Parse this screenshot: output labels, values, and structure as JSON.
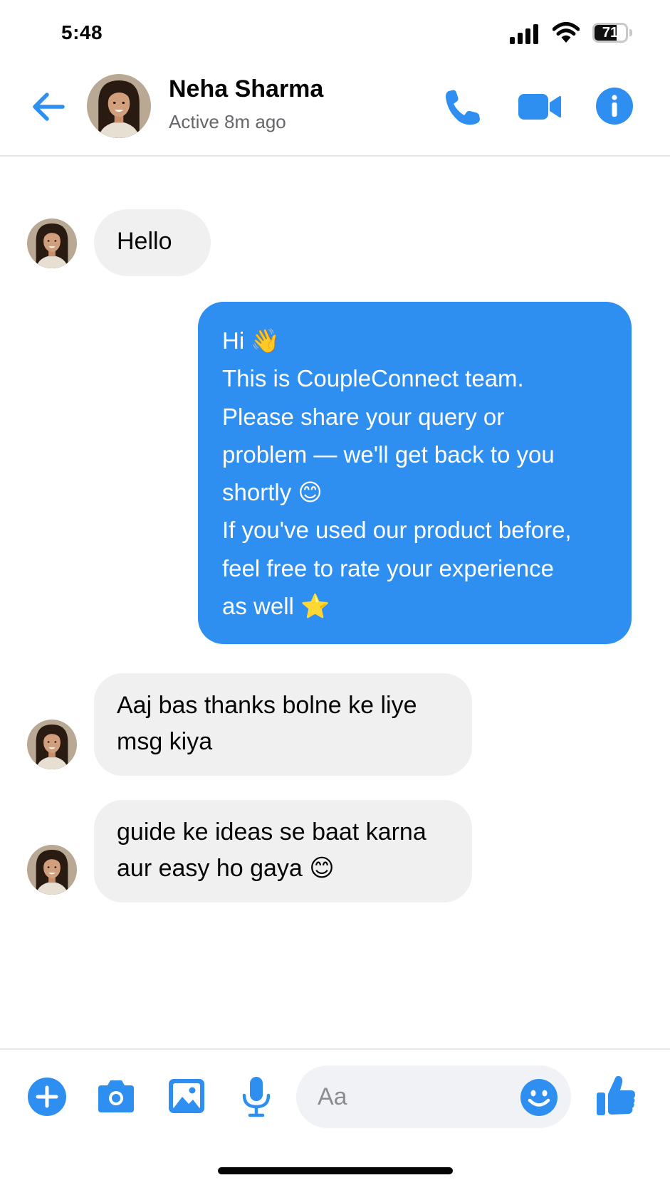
{
  "status_bar": {
    "time": "5:48",
    "battery": "71",
    "battery_level": 0.71
  },
  "header": {
    "contact_name": "Neha Sharma",
    "contact_status": "Active 8m ago"
  },
  "messages": [
    {
      "direction": "incoming",
      "lines": [
        "Hello"
      ]
    },
    {
      "direction": "outgoing",
      "lines": [
        "Hi 👋",
        "This is CoupleConnect team.",
        "Please share your query or",
        "problem — we'll get back to you",
        "shortly 😊",
        "If you've used our product before,",
        "feel free to rate your experience",
        "as well ⭐"
      ]
    },
    {
      "direction": "incoming",
      "lines": [
        "Aaj bas thanks bolne ke liye",
        "msg kiya"
      ]
    },
    {
      "direction": "incoming",
      "lines": [
        "guide ke ideas se baat karna",
        "aur easy ho gaya 😊"
      ]
    }
  ],
  "composer": {
    "placeholder": "Aa"
  },
  "colors": {
    "accent": "#2e8ff0",
    "incoming_bubble": "#f0f0f0",
    "secondary_text": "#65676b"
  },
  "icons": [
    "back-arrow-icon",
    "phone-icon",
    "video-camera-icon",
    "info-icon",
    "plus-icon",
    "camera-icon",
    "gallery-icon",
    "microphone-icon",
    "smiley-icon",
    "thumbs-up-icon"
  ]
}
